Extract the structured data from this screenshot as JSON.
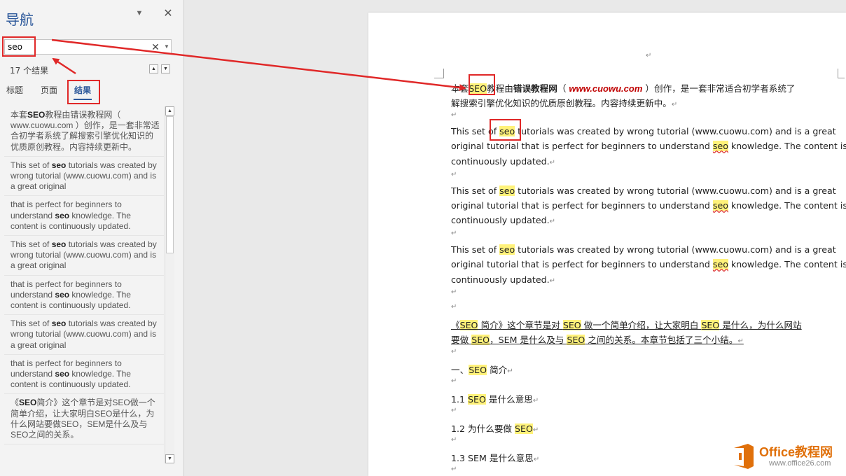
{
  "nav": {
    "title": "导航",
    "search_value": "seo",
    "result_count": "17 个结果",
    "tabs": [
      {
        "label": "标题"
      },
      {
        "label": "页面"
      },
      {
        "label": "结果"
      }
    ],
    "results": [
      {
        "pre": "本套",
        "hit": "SEO",
        "post": "教程由错误教程网（ www.cuowu.com ）创作，是一套非常适合初学者系统了解搜索引擎优化知识的优质原创教程。内容持续更新中。"
      },
      {
        "pre": "This set of ",
        "hit": "seo",
        "post": " tutorials was created by wrong tutorial (www.cuowu.com) and is a great original"
      },
      {
        "pre": "that is perfect for beginners to understand ",
        "hit": "seo",
        "post": " knowledge. The content is continuously updated."
      },
      {
        "pre": "This set of ",
        "hit": "seo",
        "post": " tutorials was created by wrong tutorial (www.cuowu.com) and is a great original"
      },
      {
        "pre": "that is perfect for beginners to understand ",
        "hit": "seo",
        "post": " knowledge. The content is continuously updated."
      },
      {
        "pre": "This set of ",
        "hit": "seo",
        "post": " tutorials was created by wrong tutorial (www.cuowu.com) and is a great original"
      },
      {
        "pre": "that is perfect for beginners to understand ",
        "hit": "seo",
        "post": " knowledge. The content is continuously updated."
      },
      {
        "pre": "《",
        "hit": "SEO",
        "post": "简介》这个章节是对SEO做一个简单介绍，让大家明白SEO是什么，为什么网站要做SEO，SEM是什么及与SEO之间的关系。"
      }
    ]
  },
  "doc": {
    "p1a": {
      "s1": "本套",
      "h1": "SEO",
      "s2": "教程由",
      "b1": "错误教程网",
      "s3": "（ ",
      "link": "www.cuowu.com",
      "s4": " ）创作，是一套非常适合初学者系统了"
    },
    "p1b": "解搜索引擎优化知识的优质原创教程。内容持续更新中。",
    "en1": {
      "s1": "This set of ",
      "h1": "seo",
      "s2": " tutorials was created by wrong tutorial (www.cuowu.com) and is a great"
    },
    "en2": {
      "s1": "original tutorial that is perfect for beginners to understand ",
      "h1": "seo",
      "s2": " knowledge. The content is"
    },
    "en3": "continuously updated.",
    "intro1": {
      "s1": "《",
      "h1": "SEO",
      "s2": " 简介》这个章节是对 ",
      "h2": "SEO",
      "s3": " 做一个简单介绍，让大家明白 ",
      "h3": "SEO",
      "s4": " 是什么，为什么网站"
    },
    "intro2": {
      "s1": "要做 ",
      "h1": "SEO",
      "s2": "，SEM 是什么及与 ",
      "h2": "SEO",
      "s3": " 之间的关系。本章节包括了三个小结。"
    },
    "h_one": {
      "s1": "一、",
      "h1": "SEO",
      "s2": " 简介"
    },
    "h11": {
      "s1": "1.1 ",
      "h1": "SEO",
      "s2": " 是什么意思"
    },
    "h12": {
      "s1": "1.2  为什么要做 ",
      "h1": "SEO"
    },
    "h13": "1.3 SEM 是什么意思",
    "para_mark": "↵"
  },
  "logo": {
    "name": "Office教程网",
    "url": "www.office26.com"
  },
  "colors": {
    "accent": "#2b579a",
    "highlight": "#fff27a",
    "annotation": "#e02828",
    "logo": "#e0700a"
  }
}
